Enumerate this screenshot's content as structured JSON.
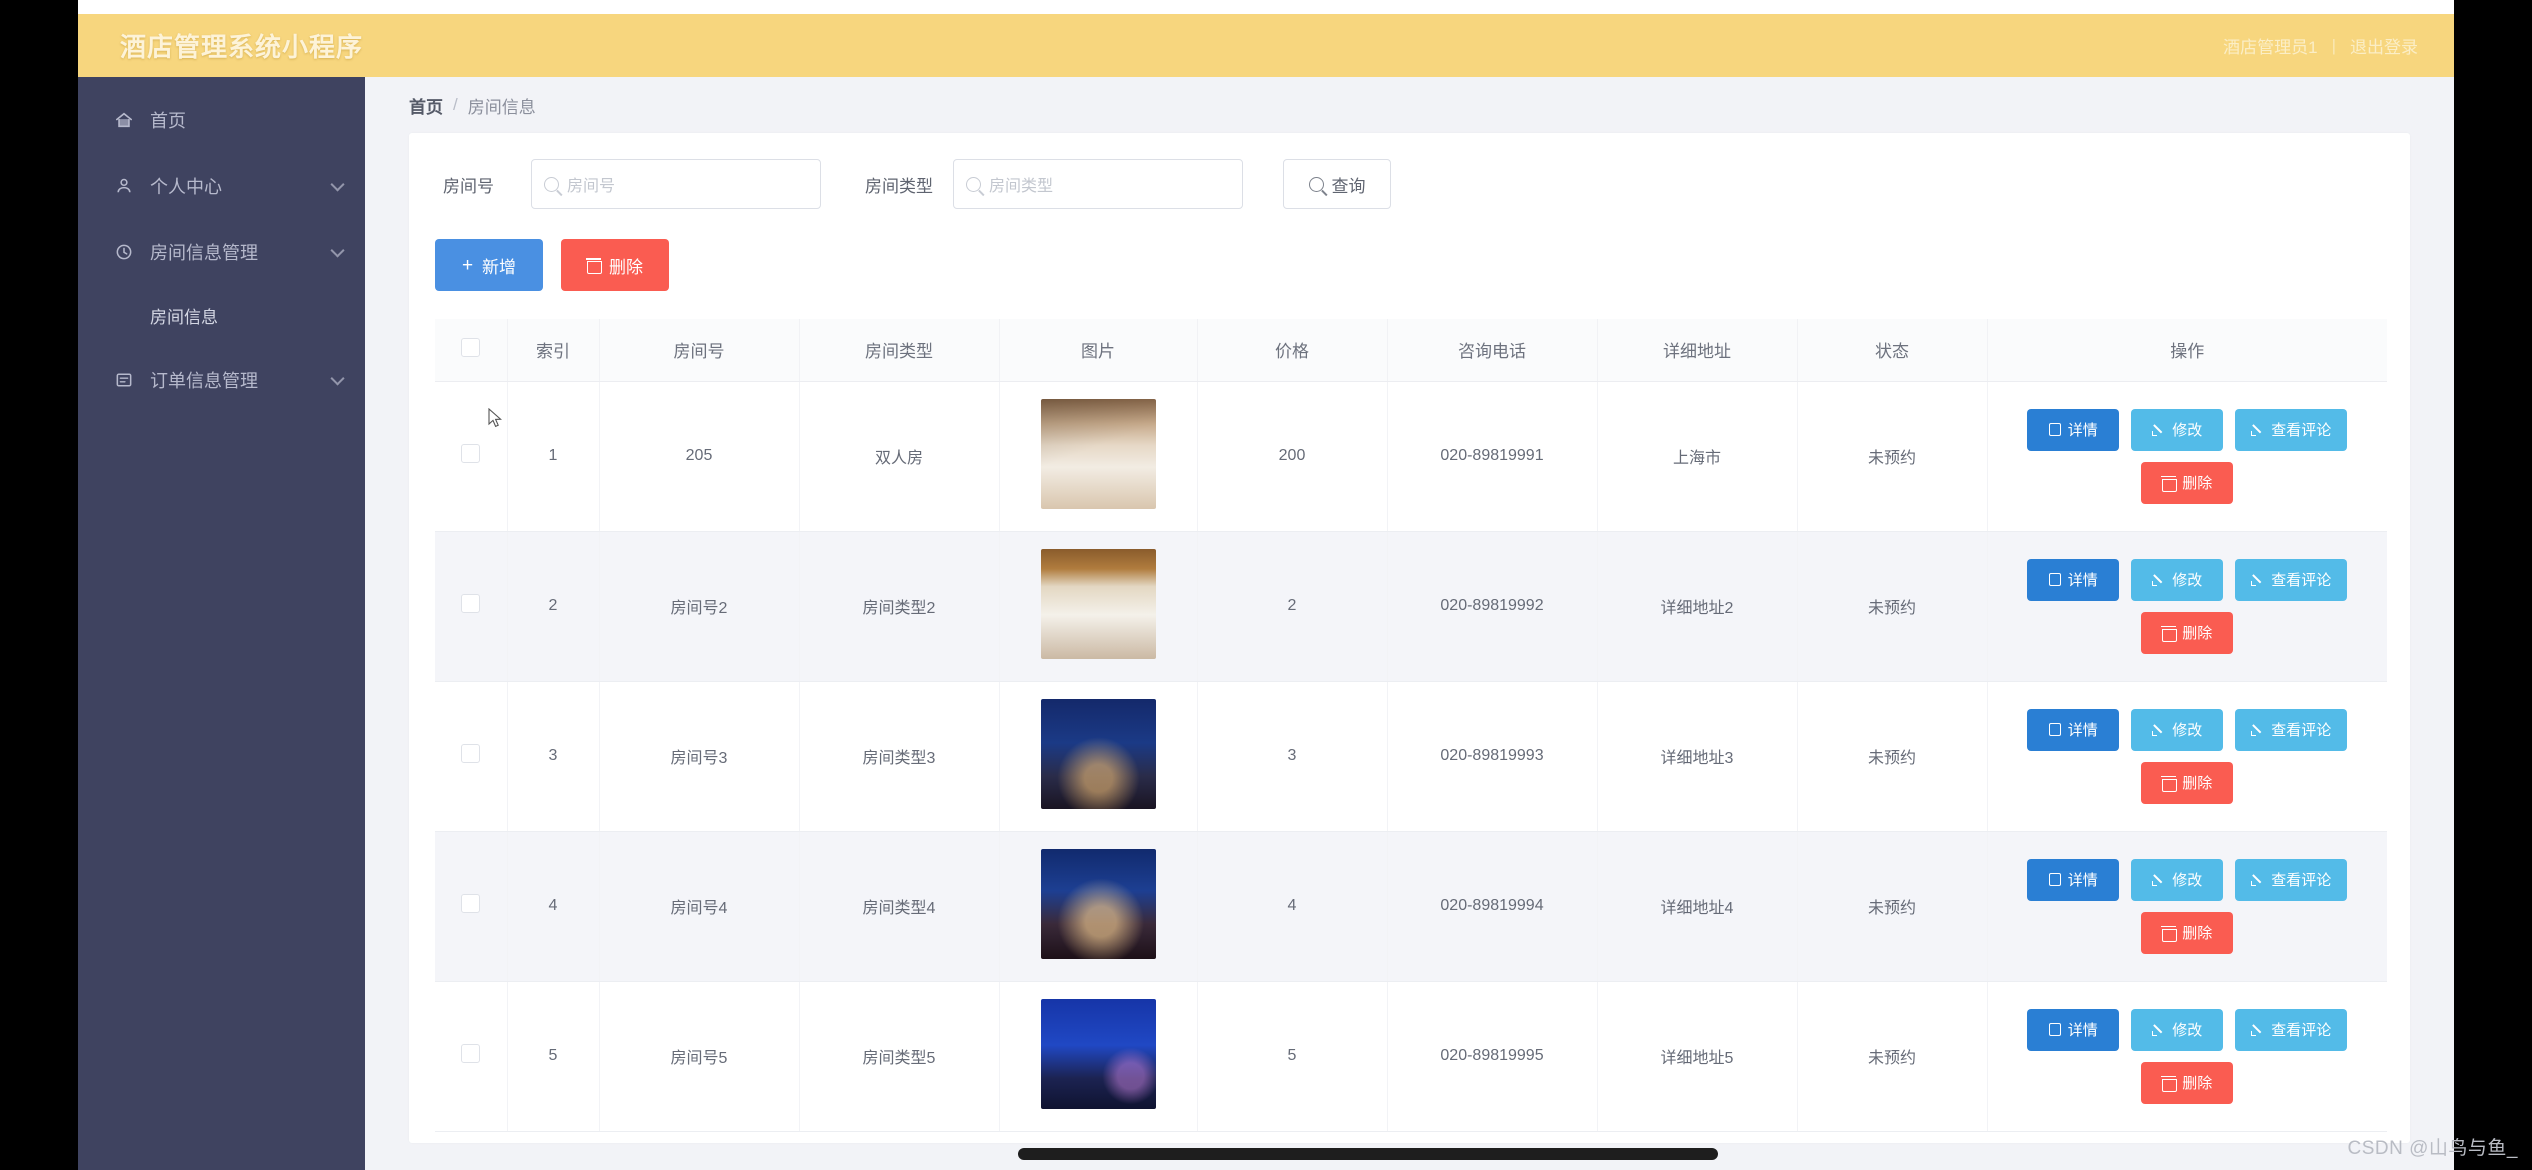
{
  "header": {
    "brand": "酒店管理系统小程序",
    "user": "酒店管理员1",
    "separator": "|",
    "logout": "退出登录"
  },
  "sidebar": {
    "items": [
      {
        "label": "首页",
        "icon": "home-icon",
        "has_caret": false,
        "sub": false
      },
      {
        "label": "个人中心",
        "icon": "user-icon",
        "has_caret": true,
        "sub": false
      },
      {
        "label": "房间信息管理",
        "icon": "clock-icon",
        "has_caret": true,
        "sub": false
      },
      {
        "label": "房间信息",
        "icon": "",
        "has_caret": false,
        "sub": true
      },
      {
        "label": "订单信息管理",
        "icon": "list-icon",
        "has_caret": true,
        "sub": false
      }
    ]
  },
  "breadcrumb": {
    "root": "首页",
    "slash": "/",
    "current": "房间信息"
  },
  "search": {
    "room_no_label": "房间号",
    "room_no_placeholder": "房间号",
    "room_no_value": "",
    "room_type_label": "房间类型",
    "room_type_placeholder": "房间类型",
    "room_type_value": "",
    "button": "查询"
  },
  "toolbar": {
    "add_label": "新增",
    "delete_label": "删除"
  },
  "table": {
    "columns": [
      "",
      "索引",
      "房间号",
      "房间类型",
      "图片",
      "价格",
      "咨询电话",
      "详细地址",
      "状态",
      "操作"
    ],
    "op_labels": {
      "detail": "详情",
      "edit": "修改",
      "comments": "查看评论",
      "delete": "删除"
    },
    "rows": [
      {
        "index": "1",
        "room_no": "205",
        "room_type": "双人房",
        "image": "bedA",
        "price": "200",
        "phone": "020-89819991",
        "address": "上海市",
        "status": "未预约"
      },
      {
        "index": "2",
        "room_no": "房间号2",
        "room_type": "房间类型2",
        "image": "bedB",
        "price": "2",
        "phone": "020-89819992",
        "address": "详细地址2",
        "status": "未预约"
      },
      {
        "index": "3",
        "room_no": "房间号3",
        "room_type": "房间类型3",
        "image": "cityA",
        "price": "3",
        "phone": "020-89819993",
        "address": "详细地址3",
        "status": "未预约"
      },
      {
        "index": "4",
        "room_no": "房间号4",
        "room_type": "房间类型4",
        "image": "cityB",
        "price": "4",
        "phone": "020-89819994",
        "address": "详细地址4",
        "status": "未预约"
      },
      {
        "index": "5",
        "room_no": "房间号5",
        "room_type": "房间类型5",
        "image": "cityC",
        "price": "5",
        "phone": "020-89819995",
        "address": "详细地址5",
        "status": "未预约"
      }
    ]
  },
  "watermark": "CSDN @山鸟与鱼_",
  "colors": {
    "header_bg": "#f7d67e",
    "sidebar_bg": "#3f4360",
    "primary": "#4a90e2",
    "danger": "#fa5c51",
    "info": "#53bbe8",
    "detail": "#2a7fd4"
  }
}
